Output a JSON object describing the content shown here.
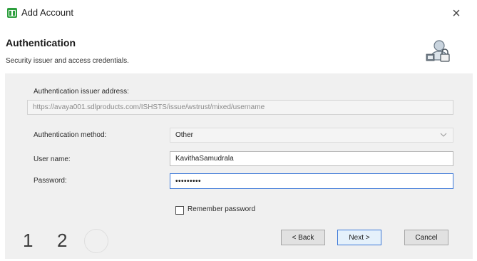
{
  "window": {
    "title": "Add Account",
    "app_icon": "account-book-icon",
    "close_glyph": "×"
  },
  "header": {
    "title": "Authentication",
    "subtitle": "Security issuer and access credentials.",
    "icon": "user-lock-icon"
  },
  "form": {
    "issuer_label": "Authentication issuer address:",
    "issuer_value": "https://avaya001.sdlproducts.com/ISHSTS/issue/wstrust/mixed/username",
    "method_label": "Authentication method:",
    "method_value": "Other",
    "username_label": "User name:",
    "username_value": "KavithaSamudrala",
    "password_label": "Password:",
    "password_value": "•••••••••",
    "remember_label": "Remember password",
    "remember_checked": false
  },
  "wizard": {
    "steps": [
      "1",
      "2"
    ]
  },
  "buttons": {
    "back": "< Back",
    "next": "Next >",
    "cancel": "Cancel"
  },
  "colors": {
    "accent": "#3c78d8",
    "panel_bg": "#f0f0f0",
    "app_icon": "#2e9f3e"
  }
}
